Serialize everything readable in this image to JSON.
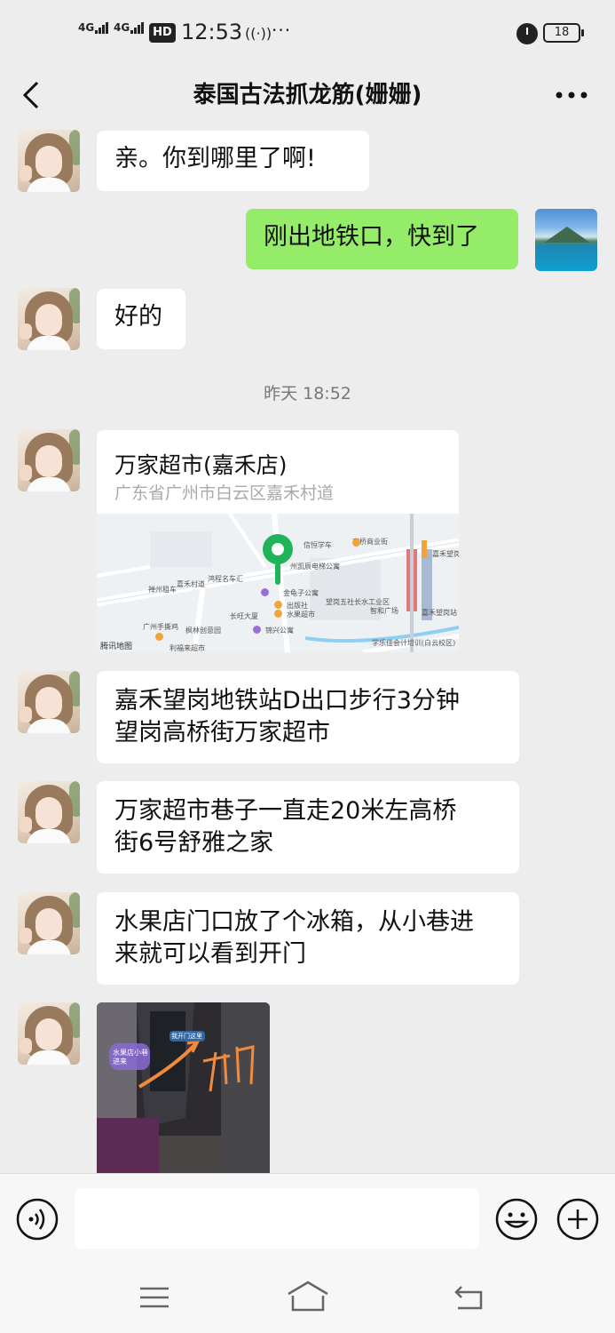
{
  "status_bar": {
    "signal_1": "4G",
    "signal_2": "4G",
    "hd_badge": "HD",
    "time": "12:53",
    "more": "···",
    "battery": "18"
  },
  "header": {
    "title": "泰国古法抓龙筋(姗姗)"
  },
  "messages": {
    "m1": "亲。你到哪里了啊!",
    "m2": "刚出地铁口，快到了",
    "m3": "好的",
    "timestamp": "昨天 18:52",
    "location": {
      "name": "万家超市(嘉禾店)",
      "address": "广东省广州市白云区嘉禾村道",
      "map_labels": {
        "l1": "信恒学车",
        "l2": "高桥商业街",
        "l3": "嘉禾望岗公交枢纽",
        "l4": "嘉禾村道",
        "l5": "鸿程名车汇",
        "l6": "禅州租车",
        "l7": "州凯辰电梯公寓",
        "l8": "金龟子公寓",
        "l9": "出版社",
        "l10": "水果超市",
        "l11": "长旺大厦",
        "l12": "广州手撕鸡",
        "l13": "枫林创意园",
        "l14": "锦兴公寓",
        "l15": "望岗五社长水工业区",
        "l16": "智和广场",
        "l17": "嘉禾望岗站",
        "l18": "学乐佳会计培训(白云校区)",
        "l19": "利福来超市",
        "l20": "腾讯地图"
      }
    },
    "m4_line1": "嘉禾望岗地铁站D出口步行3分钟",
    "m4_line2": "望岗高桥街万家超市",
    "m5_line1": "万家超市巷子一直走20米左高桥",
    "m5_line2": "街6号舒雅之家",
    "m6_line1": "水果店门口放了个冰箱，从小巷进",
    "m6_line2": "来就可以看到开门",
    "photo": {
      "sign_left": "水果店小巷进来",
      "sign_top": "我开门这里",
      "handwriting": "开门"
    }
  },
  "input": {
    "placeholder": ""
  },
  "colors": {
    "background": "#ededed",
    "self_bubble": "#95ec69",
    "other_bubble": "#ffffff",
    "map_pin": "#1fb35a"
  }
}
